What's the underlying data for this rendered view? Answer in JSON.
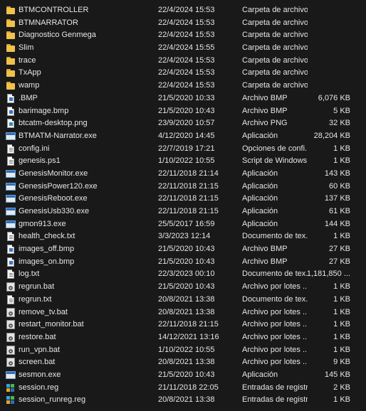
{
  "files": [
    {
      "name": "BTMCONTROLLER",
      "date": "22/4/2024 15:53",
      "type": "Carpeta de archivos",
      "size": "",
      "icon": "folder-icon"
    },
    {
      "name": "BTMNARRATOR",
      "date": "22/4/2024 15:53",
      "type": "Carpeta de archivos",
      "size": "",
      "icon": "folder-icon"
    },
    {
      "name": "Diagnostico Genmega",
      "date": "22/4/2024 15:53",
      "type": "Carpeta de archivos",
      "size": "",
      "icon": "folder-icon"
    },
    {
      "name": "Slim",
      "date": "22/4/2024 15:55",
      "type": "Carpeta de archivos",
      "size": "",
      "icon": "folder-icon"
    },
    {
      "name": "trace",
      "date": "22/4/2024 15:53",
      "type": "Carpeta de archivos",
      "size": "",
      "icon": "folder-icon"
    },
    {
      "name": "TxApp",
      "date": "22/4/2024 15:53",
      "type": "Carpeta de archivos",
      "size": "",
      "icon": "folder-icon"
    },
    {
      "name": "wamp",
      "date": "22/4/2024 15:53",
      "type": "Carpeta de archivos",
      "size": "",
      "icon": "folder-icon"
    },
    {
      "name": ".BMP",
      "date": "21/5/2020 10:33",
      "type": "Archivo BMP",
      "size": "6,076 KB",
      "icon": "bitmap-icon"
    },
    {
      "name": "barimage.bmp",
      "date": "21/5/2020 10:43",
      "type": "Archivo BMP",
      "size": "5 KB",
      "icon": "bitmap-icon"
    },
    {
      "name": "btcatm-desktop.png",
      "date": "23/9/2020 10:57",
      "type": "Archivo PNG",
      "size": "32 KB",
      "icon": "image-icon"
    },
    {
      "name": "BTMATM-Narrator.exe",
      "date": "4/12/2020 14:45",
      "type": "Aplicación",
      "size": "28,204 KB",
      "icon": "app-icon"
    },
    {
      "name": "config.ini",
      "date": "22/7/2019 17:21",
      "type": "Opciones de confi...",
      "size": "1 KB",
      "icon": "settings-file-icon"
    },
    {
      "name": "genesis.ps1",
      "date": "1/10/2022 10:55",
      "type": "Script de Windows...",
      "size": "1 KB",
      "icon": "script-icon"
    },
    {
      "name": "GenesisMonitor.exe",
      "date": "22/11/2018 21:14",
      "type": "Aplicación",
      "size": "143 KB",
      "icon": "app-icon"
    },
    {
      "name": "GenesisPower120.exe",
      "date": "22/11/2018 21:15",
      "type": "Aplicación",
      "size": "60 KB",
      "icon": "app-icon"
    },
    {
      "name": "GenesisReboot.exe",
      "date": "22/11/2018 21:15",
      "type": "Aplicación",
      "size": "137 KB",
      "icon": "app-icon"
    },
    {
      "name": "GenesisUsb330.exe",
      "date": "22/11/2018 21:15",
      "type": "Aplicación",
      "size": "61 KB",
      "icon": "app-icon"
    },
    {
      "name": "gmon913.exe",
      "date": "25/5/2017 16:59",
      "type": "Aplicación",
      "size": "144 KB",
      "icon": "app-icon"
    },
    {
      "name": "health_check.txt",
      "date": "3/3/2023 12:14",
      "type": "Documento de tex...",
      "size": "1 KB",
      "icon": "text-file-icon"
    },
    {
      "name": "images_off.bmp",
      "date": "21/5/2020 10:43",
      "type": "Archivo BMP",
      "size": "27 KB",
      "icon": "bitmap-icon"
    },
    {
      "name": "images_on.bmp",
      "date": "21/5/2020 10:43",
      "type": "Archivo BMP",
      "size": "27 KB",
      "icon": "bitmap-icon"
    },
    {
      "name": "log.txt",
      "date": "22/3/2023 00:10",
      "type": "Documento de tex...",
      "size": "1,181,850 ...",
      "icon": "text-file-icon"
    },
    {
      "name": "regrun.bat",
      "date": "21/5/2020 10:43",
      "type": "Archivo por lotes ...",
      "size": "1 KB",
      "icon": "batch-file-icon"
    },
    {
      "name": "regrun.txt",
      "date": "20/8/2021 13:38",
      "type": "Documento de tex...",
      "size": "1 KB",
      "icon": "text-file-icon"
    },
    {
      "name": "remove_tv.bat",
      "date": "20/8/2021 13:38",
      "type": "Archivo por lotes ...",
      "size": "1 KB",
      "icon": "batch-file-icon"
    },
    {
      "name": "restart_monitor.bat",
      "date": "22/11/2018 21:15",
      "type": "Archivo por lotes ...",
      "size": "1 KB",
      "icon": "batch-file-icon"
    },
    {
      "name": "restore.bat",
      "date": "14/12/2021 13:16",
      "type": "Archivo por lotes ...",
      "size": "1 KB",
      "icon": "batch-file-icon"
    },
    {
      "name": "run_vpn.bat",
      "date": "1/10/2022 10:55",
      "type": "Archivo por lotes ...",
      "size": "1 KB",
      "icon": "batch-file-icon"
    },
    {
      "name": "screen.bat",
      "date": "20/8/2021 13:38",
      "type": "Archivo por lotes ...",
      "size": "9 KB",
      "icon": "batch-file-icon"
    },
    {
      "name": "sesmon.exe",
      "date": "21/5/2020 10:43",
      "type": "Aplicación",
      "size": "145 KB",
      "icon": "app-icon"
    },
    {
      "name": "session.reg",
      "date": "21/11/2018 22:05",
      "type": "Entradas de registro",
      "size": "2 KB",
      "icon": "registry-icon"
    },
    {
      "name": "session_runreg.reg",
      "date": "20/8/2021 13:38",
      "type": "Entradas de registro",
      "size": "1 KB",
      "icon": "registry-icon"
    }
  ],
  "colors": {
    "background": "#191919",
    "text": "#e6e6e6",
    "folder": "#f0c14b"
  }
}
